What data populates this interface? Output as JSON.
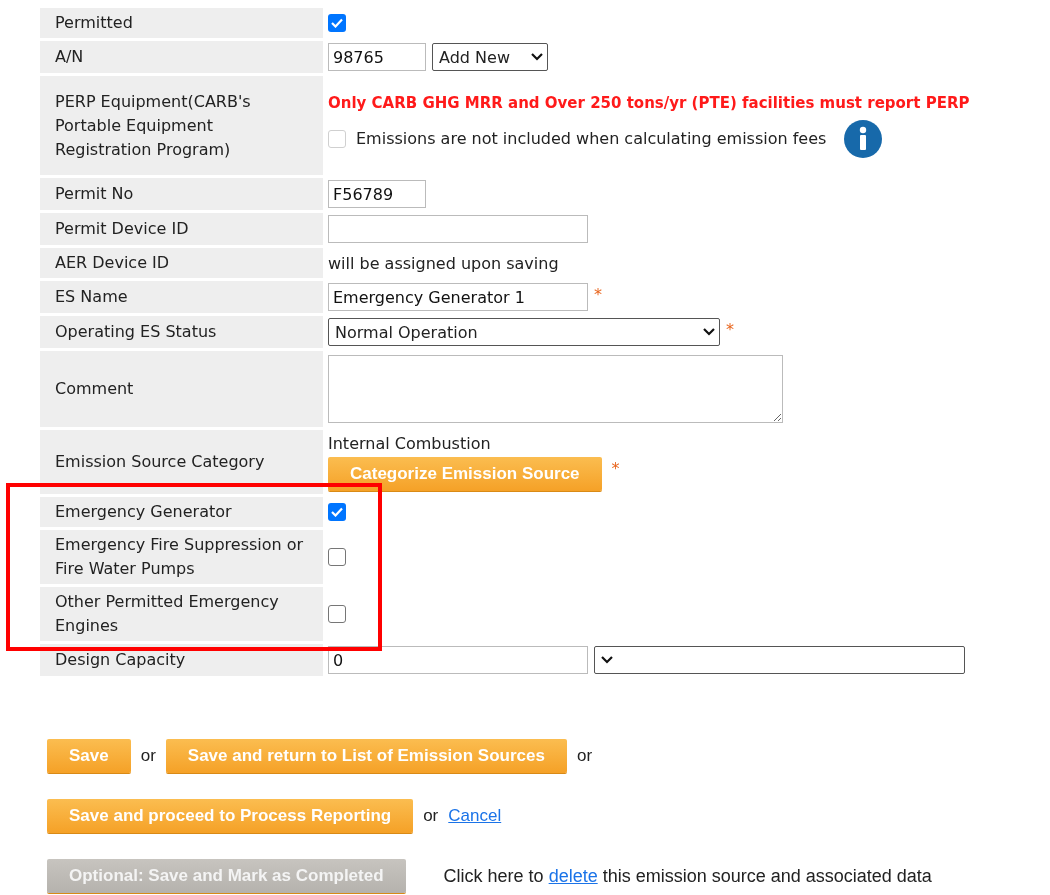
{
  "rows": [
    {
      "label": "Permitted",
      "kind": "checkbox",
      "checked": true
    },
    {
      "label": "A/N",
      "kind": "number_with_select",
      "value": "98765",
      "select": "Add New"
    },
    {
      "label": "PERP Equipment(CARB's Portable Equipment Registration Program)",
      "kind": "perp",
      "warning": "Only CARB GHG MRR and Over 250 tons/yr (PTE) facilities must report PERP",
      "option": {
        "label": "Emissions are not included when calculating emission fees",
        "checked": false,
        "disabled": true
      }
    },
    {
      "label": "Permit No",
      "kind": "code_input",
      "value": "F56789"
    },
    {
      "label": "Permit Device ID",
      "kind": "input"
    },
    {
      "label": "AER Device ID",
      "kind": "text",
      "text": "will be assigned upon saving"
    },
    {
      "label": "ES Name",
      "kind": "input",
      "value": "Emergency Generator 1",
      "required_mark": "*"
    },
    {
      "label": "Operating ES Status",
      "kind": "select",
      "value": "Normal Operation",
      "required_mark": "*"
    },
    {
      "label": "Comment",
      "kind": "textarea"
    },
    {
      "label": "Emission Source Category",
      "kind": "category",
      "text": "Internal Combustion",
      "button": "Categorize Emission Source",
      "required_mark": "*"
    },
    {
      "label": "Emergency Generator",
      "kind": "checkbox",
      "checked": true,
      "highlighted": true
    },
    {
      "label": "Emergency Fire Suppression or Fire Water Pumps",
      "kind": "checkbox",
      "checked": false,
      "highlighted": true
    },
    {
      "label": "Other Permitted Emergency Engines",
      "kind": "checkbox",
      "checked": false,
      "highlighted": true
    },
    {
      "label": "Design Capacity",
      "kind": "quantity_with_unit",
      "value": "0"
    }
  ],
  "actions": [
    [
      {
        "kind": "button",
        "text": "Save",
        "disabled": false
      },
      {
        "kind": "text",
        "text": "or"
      },
      {
        "kind": "button",
        "text": "Save and return to List of Emission Sources",
        "disabled": false
      },
      {
        "kind": "text",
        "text": "or"
      }
    ],
    [
      {
        "kind": "button",
        "text": "Save and proceed to Process Reporting",
        "disabled": false
      },
      {
        "kind": "text",
        "text": "or"
      },
      {
        "kind": "link",
        "text": "Cancel"
      }
    ],
    [
      {
        "kind": "button",
        "text": "Optional: Save and Mark as Completed",
        "disabled": true
      },
      {
        "kind": "sentence",
        "before": "Click here to ",
        "link": "delete",
        "after": " this emission source and associated data"
      }
    ]
  ]
}
